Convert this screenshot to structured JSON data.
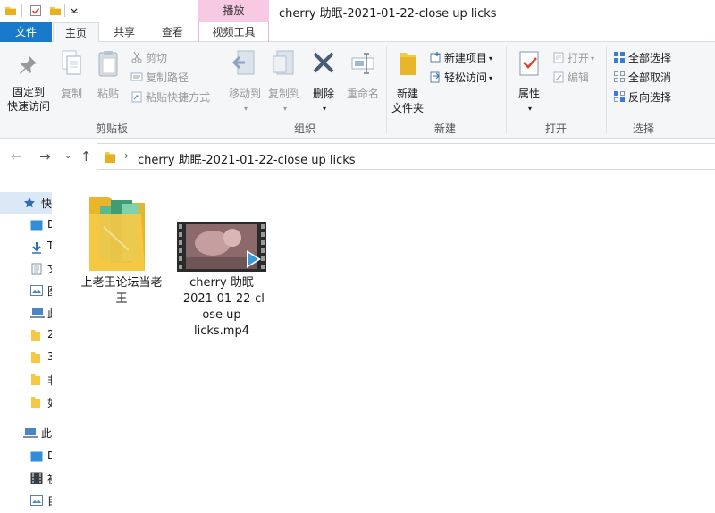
{
  "window": {
    "title": "cherry 助眠-2021-01-22-close up licks",
    "context_tab_group": "播放"
  },
  "tabs": {
    "file": "文件",
    "home": "主页",
    "share": "共享",
    "view": "查看",
    "video_tools": "视频工具"
  },
  "ribbon": {
    "clipboard": {
      "group_label": "剪贴板",
      "pin": "固定到\n快速访问",
      "pin_line1": "固定到",
      "pin_line2": "快速访问",
      "copy": "复制",
      "paste": "粘贴",
      "cut": "剪切",
      "copy_path": "复制路径",
      "paste_shortcut": "粘贴快捷方式"
    },
    "organize": {
      "group_label": "组织",
      "move_to": "移动到",
      "copy_to": "复制到",
      "delete": "删除",
      "rename": "重命名"
    },
    "new": {
      "group_label": "新建",
      "new_item": "新建项目",
      "easy_access": "轻松访问",
      "new_folder_line1": "新建",
      "new_folder_line2": "文件夹"
    },
    "open": {
      "group_label": "打开",
      "properties": "属性",
      "open": "打开",
      "edit": "编辑"
    },
    "select": {
      "group_label": "选择",
      "select_all": "全部选择",
      "select_none": "全部取消",
      "invert_selection": "反向选择"
    }
  },
  "address": {
    "path": "cherry 助眠-2021-01-22-close up licks"
  },
  "navpane": {
    "quick_access": "快",
    "this_pc": "此",
    "items": [
      "D",
      "T",
      "文",
      "图",
      "此",
      "2",
      "3",
      "非",
      "如",
      "D",
      "初",
      "目"
    ]
  },
  "files": [
    {
      "name": "上老王论坛当老王",
      "line1": "上老王论坛当老",
      "line2": "王",
      "type": "folder"
    },
    {
      "name": "cherry 助眠-2021-01-22-close up licks.mp4",
      "line1": "cherry 助眠",
      "line2": "-2021-01-22-cl",
      "line3": "ose up",
      "line4": "licks.mp4",
      "type": "video"
    }
  ],
  "colors": {
    "file_tab": "#1979ca",
    "context_tab": "#f7c9e3",
    "ribbon_bg": "#f5f6f7",
    "selection": "#dbe9f6",
    "folder": "#f5c945"
  }
}
